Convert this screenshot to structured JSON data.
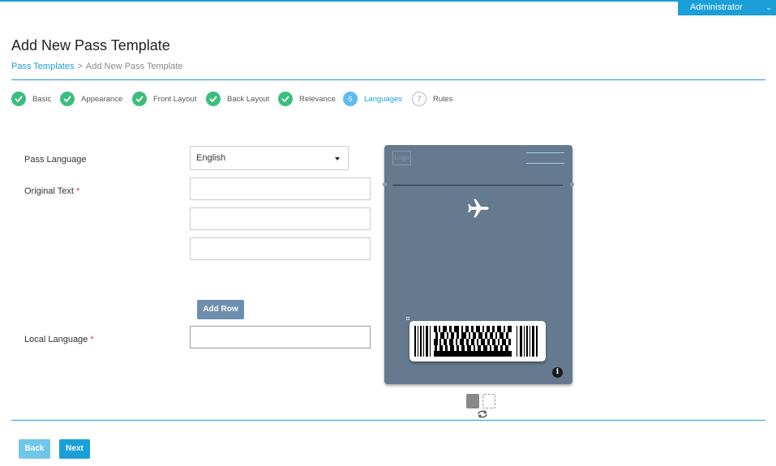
{
  "header": {
    "user_label": "Administrator"
  },
  "page": {
    "title": "Add New Pass Template",
    "breadcrumb": {
      "parent": "Pass Templates",
      "separator": ">",
      "current": "Add New Pass Template"
    }
  },
  "steps": [
    {
      "num": "",
      "label": "Basic",
      "state": "done"
    },
    {
      "num": "",
      "label": "Appearance",
      "state": "done"
    },
    {
      "num": "",
      "label": "Front Layout",
      "state": "done"
    },
    {
      "num": "",
      "label": "Back Layout",
      "state": "done"
    },
    {
      "num": "",
      "label": "Relevance",
      "state": "done"
    },
    {
      "num": "6",
      "label": "Languages",
      "state": "active"
    },
    {
      "num": "7",
      "label": "Rules",
      "state": "todo"
    }
  ],
  "form": {
    "pass_language_label": "Pass Language",
    "pass_language_value": "English",
    "original_text_label": "Original Text",
    "required_mark": "*",
    "original_text_values": [
      "",
      "",
      ""
    ],
    "add_row_label": "Add Row",
    "local_language_label": "Local Language",
    "local_language_value": ""
  },
  "preview": {
    "logo_text": "Logo",
    "info_icon": "i",
    "background": "#65798f"
  },
  "footer": {
    "back_label": "Back",
    "next_label": "Next"
  },
  "colors": {
    "accent": "#1a9fd9",
    "done": "#3dbd7d",
    "active": "#5dbdf0"
  }
}
